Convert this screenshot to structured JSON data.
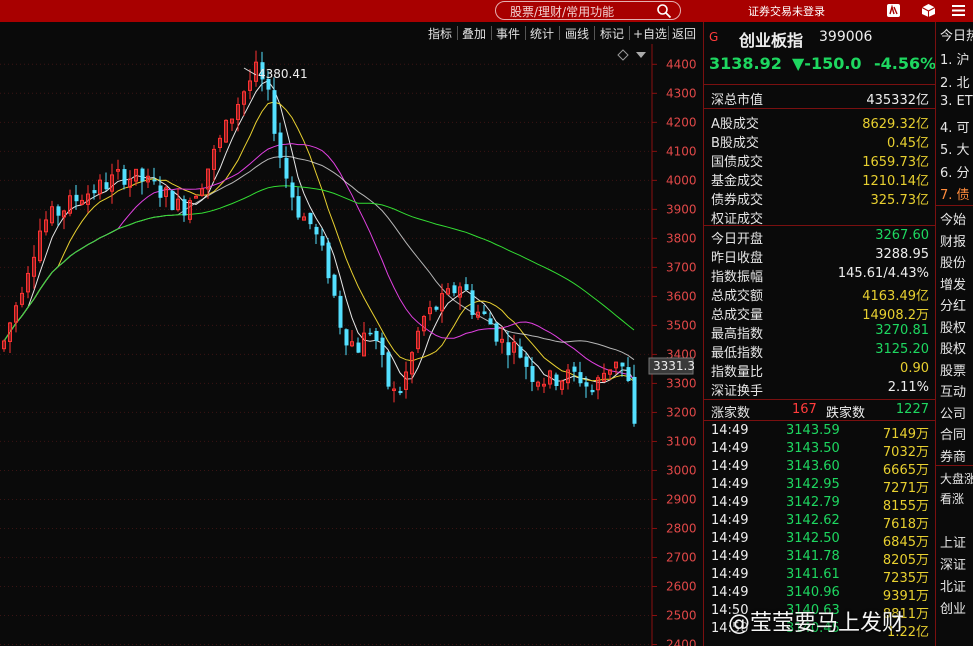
{
  "topbar": {
    "search_placeholder": "股票/理财/常用功能",
    "login_status": "证券交易未登录"
  },
  "toolbar": {
    "items": [
      "指标",
      "叠加",
      "事件",
      "统计",
      "画线",
      "标记",
      "+自选",
      "返回"
    ]
  },
  "chart_data": {
    "type": "candlestick",
    "y_ticks": [
      4400,
      4300,
      4200,
      4100,
      4000,
      3900,
      3800,
      3700,
      3600,
      3500,
      3400,
      3300,
      3200,
      3100,
      3000,
      2900,
      2800,
      2700,
      2600,
      2500,
      2400
    ],
    "ylim": [
      2400,
      4420
    ],
    "max_label": "4380.41",
    "current_label": "3331.3",
    "colors": {
      "up": "#ff3232",
      "down": "#54e0ff",
      "ma5": "#ffffff",
      "ma10": "#e8d030",
      "ma20": "#e040e0",
      "ma30": "#ffffff",
      "ma60": "#33dd33"
    }
  },
  "quote": {
    "flag": "G",
    "name": "创业板指",
    "code": "399006",
    "price": "3138.92",
    "change": "▼-150.0",
    "change_pct": "-4.56%",
    "market_cap_label": "深总市值",
    "market_cap_value": "435332亿",
    "turnover_rows": [
      {
        "label": "A股成交",
        "value": "8629.32亿"
      },
      {
        "label": "B股成交",
        "value": "0.45亿"
      },
      {
        "label": "国债成交",
        "value": "1659.73亿"
      },
      {
        "label": "基金成交",
        "value": "1210.14亿"
      },
      {
        "label": "债券成交",
        "value": "325.73亿"
      },
      {
        "label": "权证成交",
        "value": ""
      }
    ],
    "stat_rows": [
      {
        "label": "今日开盘",
        "value": "3267.60",
        "color": "g"
      },
      {
        "label": "昨日收盘",
        "value": "3288.95",
        "color": "w"
      },
      {
        "label": "指数振幅",
        "value": "145.61/4.43%",
        "color": "w"
      },
      {
        "label": "总成交额",
        "value": "4163.49亿",
        "color": "y"
      },
      {
        "label": "总成交量",
        "value": "14908.2万",
        "color": "y"
      },
      {
        "label": "最高指数",
        "value": "3270.81",
        "color": "g"
      },
      {
        "label": "最低指数",
        "value": "3125.20",
        "color": "g"
      },
      {
        "label": "指数量比",
        "value": "0.90",
        "color": "y"
      },
      {
        "label": "深证换手",
        "value": "2.11%",
        "color": "w"
      }
    ],
    "up_label": "涨家数",
    "up_count": "167",
    "down_label": "跌家数",
    "down_count": "1227",
    "ticks": [
      {
        "time": "14:49",
        "price": "3143.59",
        "vol": "7149万"
      },
      {
        "time": "14:49",
        "price": "3143.50",
        "vol": "7032万"
      },
      {
        "time": "14:49",
        "price": "3143.60",
        "vol": "6665万"
      },
      {
        "time": "14:49",
        "price": "3142.95",
        "vol": "7271万"
      },
      {
        "time": "14:49",
        "price": "3142.79",
        "vol": "8155万"
      },
      {
        "time": "14:49",
        "price": "3142.62",
        "vol": "7618万"
      },
      {
        "time": "14:49",
        "price": "3142.50",
        "vol": "6845万"
      },
      {
        "time": "14:49",
        "price": "3141.78",
        "vol": "8205万"
      },
      {
        "time": "14:49",
        "price": "3141.61",
        "vol": "7235万"
      },
      {
        "time": "14:49",
        "price": "3140.96",
        "vol": "9391万"
      },
      {
        "time": "14:50",
        "price": "3140.63",
        "vol": "8811万"
      },
      {
        "time": "14:50",
        "price": "3140.45",
        "vol": "1.22亿"
      }
    ]
  },
  "news": {
    "title": "今日热",
    "items": [
      "1. 沪",
      "2. 北",
      "3. ET",
      "4. 可",
      "5. 大",
      "6. 分",
      "7. 债"
    ],
    "links": [
      "今始",
      "财报",
      "股份",
      "增发",
      "分红",
      "股权",
      "股权",
      "股票",
      "互动",
      "公司",
      "合同",
      "券商"
    ],
    "board_title": "大盘涨",
    "board_tag": "看涨",
    "index_links": [
      "上证",
      "深证",
      "北证",
      "创业"
    ]
  },
  "watermark": "@莹莹要马上发财"
}
